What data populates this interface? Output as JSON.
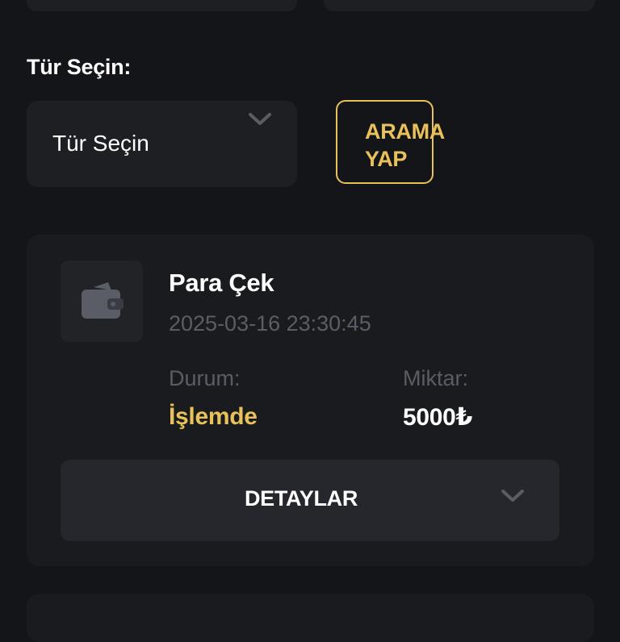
{
  "filter": {
    "label": "Tür Seçin:",
    "select_value": "Tür Seçin",
    "search_label": "ARAMA\nYAP"
  },
  "transaction": {
    "title": "Para Çek",
    "date": "2025-03-16 23:30:45",
    "status_label": "Durum:",
    "status_value": "İşlemde",
    "amount_label": "Miktar:",
    "amount_value": "5000₺",
    "details_label": "DETAYLAR",
    "icon": "wallet-icon"
  },
  "colors": {
    "background": "#141518",
    "card": "#1a1b1f",
    "accent": "#e8c15a",
    "muted_text": "#5a5d66"
  }
}
